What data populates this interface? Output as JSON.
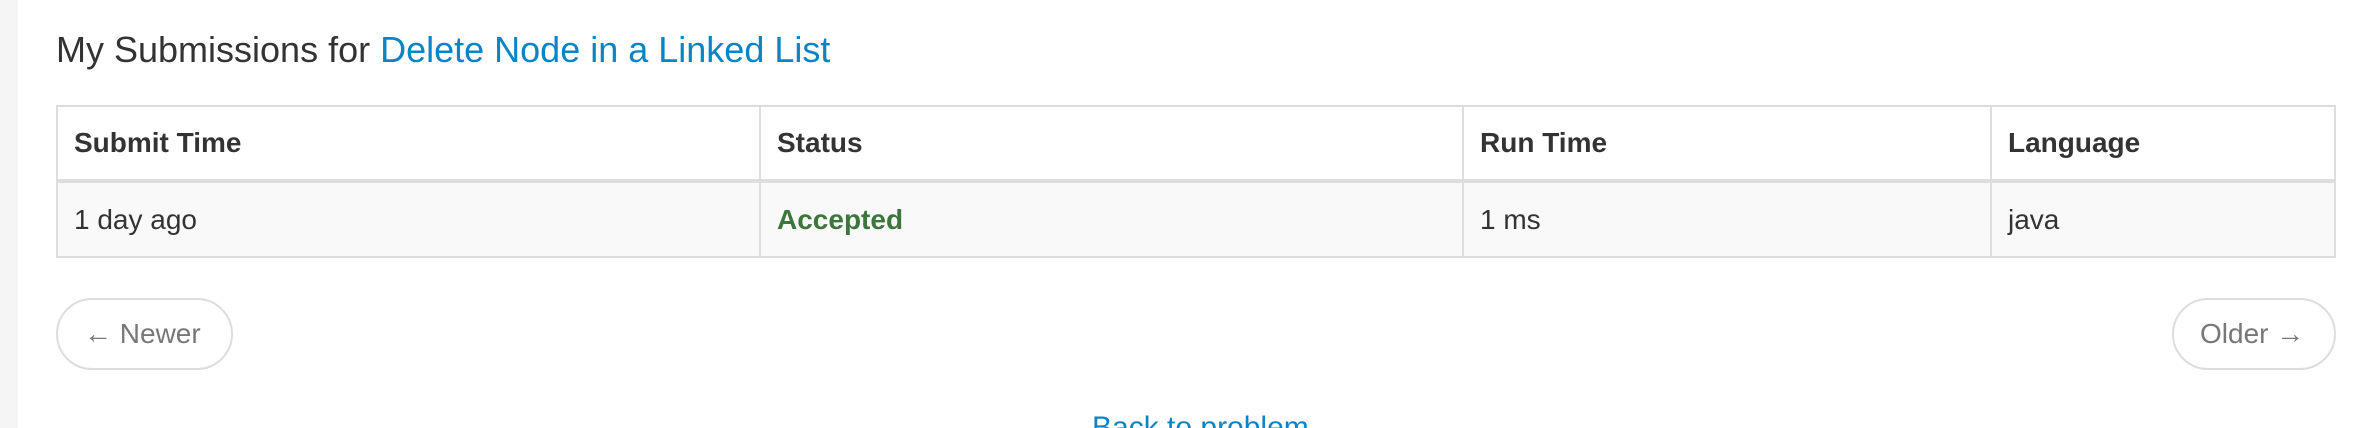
{
  "page": {
    "title_prefix": "My Submissions for ",
    "problem_link": "Delete Node in a Linked List"
  },
  "table": {
    "headers": [
      "Submit Time",
      "Status",
      "Run Time",
      "Language"
    ],
    "rows": [
      {
        "submit_time": "1 day ago",
        "status": "Accepted",
        "run_time": "1 ms",
        "language": "java"
      }
    ]
  },
  "pager": {
    "newer_label": "← Newer",
    "older_label": "Older →"
  },
  "footer": {
    "back_link_label": "Back to problem"
  },
  "colors": {
    "link": "#0b84c6",
    "accepted": "#3c763d",
    "border": "#dddddd",
    "row_background": "#f9f9f9"
  }
}
